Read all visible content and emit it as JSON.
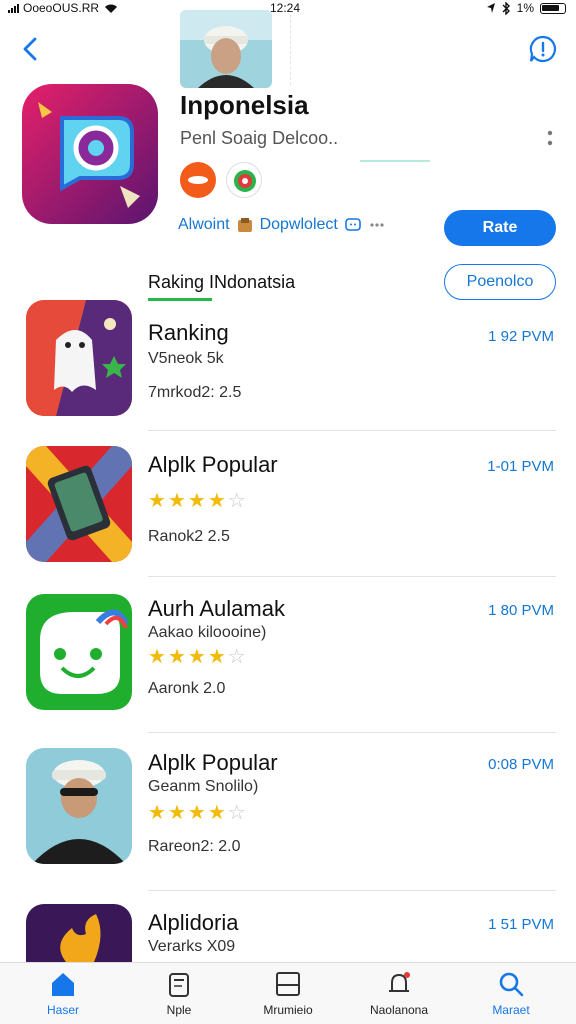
{
  "status": {
    "carrier": "OoeoOUS.RR",
    "time": "12:24",
    "battery": "1%"
  },
  "header": {
    "app_title": "Inponelsia",
    "app_subtitle": "Penl Soaig Delcoo..",
    "meta_left": "Alwoint",
    "meta_right": "Dopwlolect",
    "rate_button": "Rate"
  },
  "section": {
    "title": "Raking INdonatsia",
    "action_button": "Poenolco"
  },
  "list": [
    {
      "name": "Ranking",
      "line2": "V5neok 5k",
      "line3": "7mrkod2: 2.5",
      "time": "1 92 PVM",
      "rating": null
    },
    {
      "name": "Alplk Popular",
      "line2": "",
      "line3": "Ranok2 2.5",
      "time": "1-01 PVM",
      "rating": 3.5
    },
    {
      "name": "Aurh Aulamak",
      "line2": "Aakao kiloooine)",
      "line3": "Aaronk 2.0",
      "time": "1 80 PVM",
      "rating": 4
    },
    {
      "name": "Alplk Popular",
      "line2": "Geanm Snolilo)",
      "line3": "Rareon2: 2.0",
      "time": "0:08 PVM",
      "rating": 4
    },
    {
      "name": "Alplidoria",
      "line2": "Verarks X09",
      "line3": "",
      "time": "1 51 PVM",
      "rating": null
    }
  ],
  "tabs": [
    {
      "label": "Haser",
      "icon": "home-icon",
      "active": true
    },
    {
      "label": "Nple",
      "icon": "calendar-icon",
      "active": false
    },
    {
      "label": "Mrumieio",
      "icon": "square-icon",
      "active": false
    },
    {
      "label": "Naolanona",
      "icon": "bell-icon",
      "active": false
    },
    {
      "label": "Maraet",
      "icon": "search-icon",
      "active": true
    }
  ],
  "colors": {
    "accent": "#1577ea",
    "star": "#f2bb0a",
    "green": "#25b84a"
  }
}
